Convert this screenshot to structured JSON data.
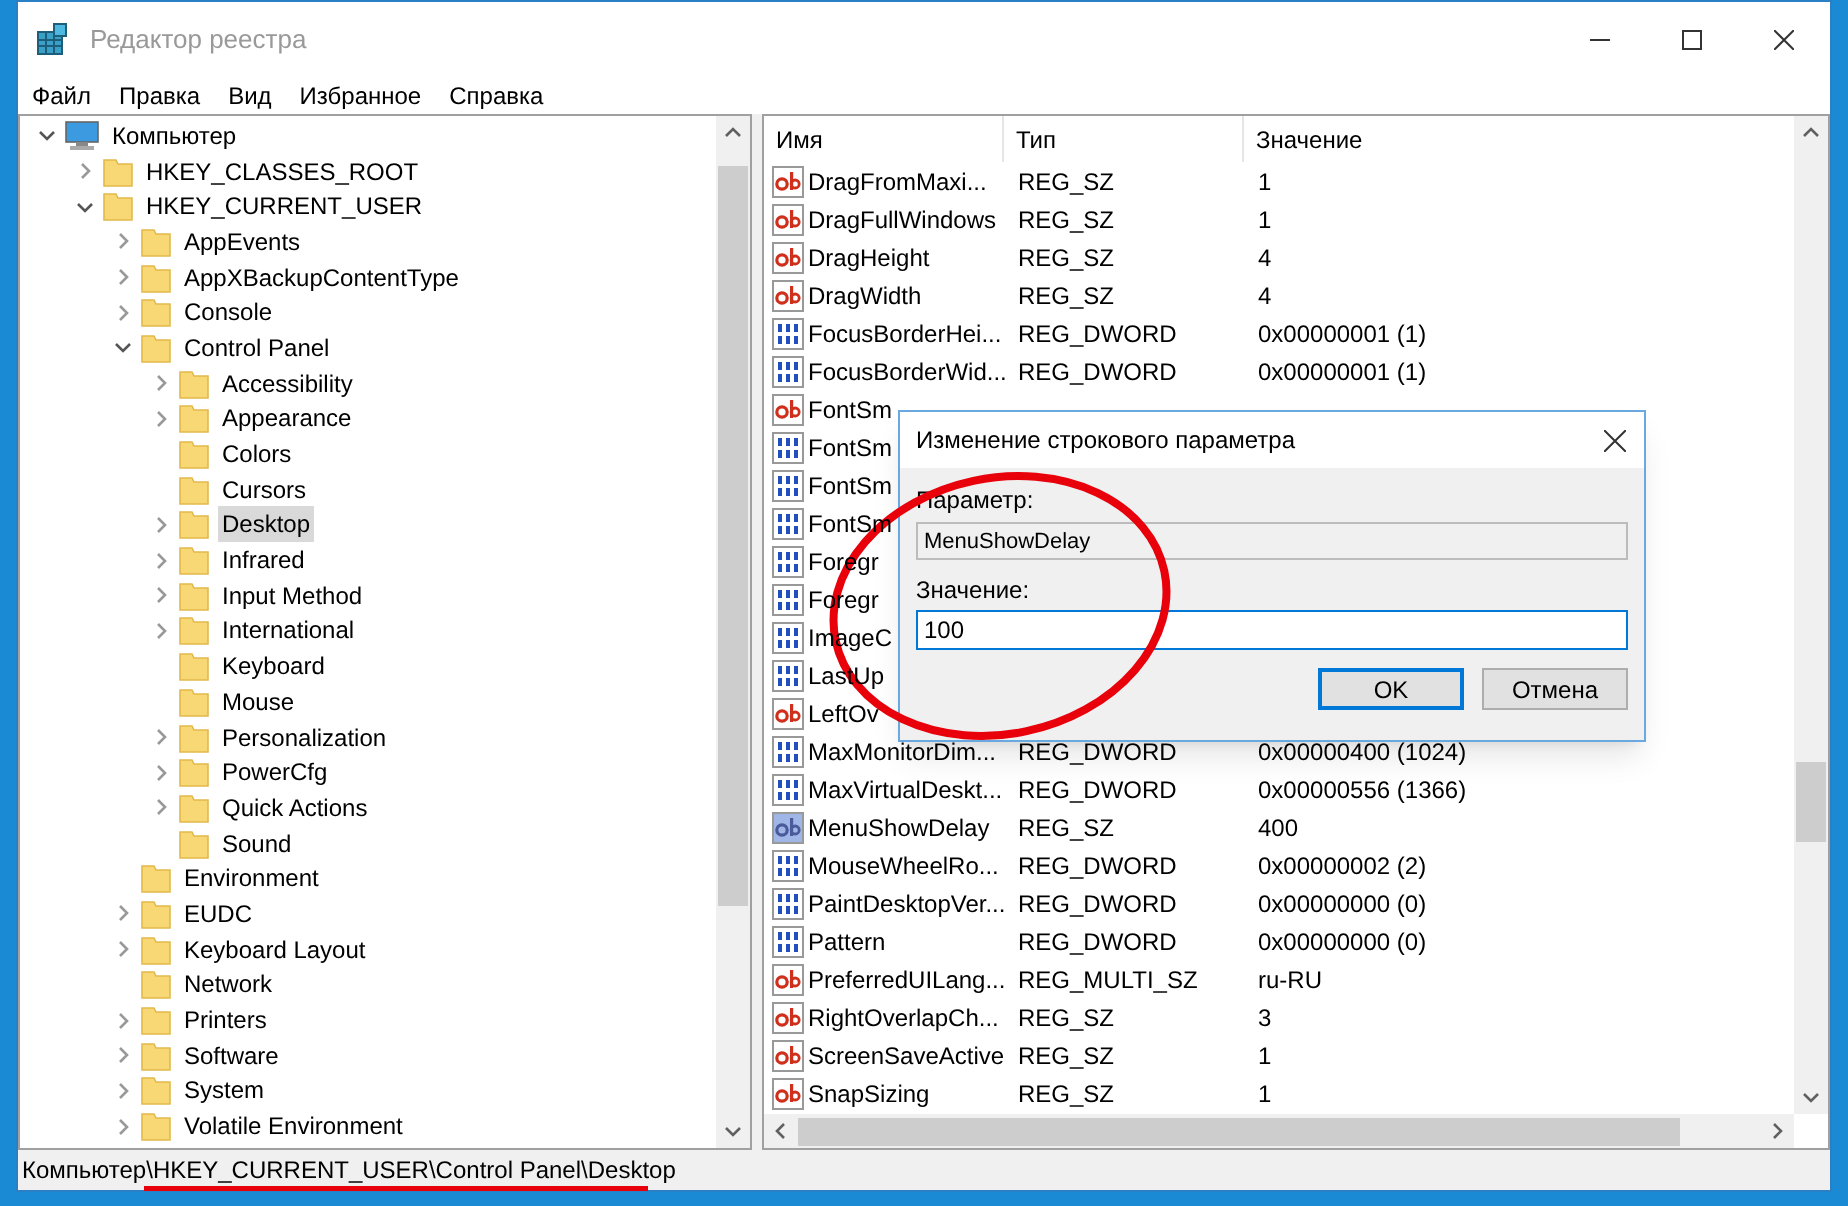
{
  "window": {
    "title": "Редактор реестра"
  },
  "menu": [
    "Файл",
    "Правка",
    "Вид",
    "Избранное",
    "Справка"
  ],
  "tree": [
    {
      "label": "Компьютер",
      "kind": "computer",
      "expandable": true,
      "expanded": true,
      "selected": false,
      "children": [
        {
          "label": "HKEY_CLASSES_ROOT",
          "expandable": true,
          "expanded": false,
          "selected": false
        },
        {
          "label": "HKEY_CURRENT_USER",
          "expandable": true,
          "expanded": true,
          "selected": false,
          "children": [
            {
              "label": "AppEvents",
              "expandable": true,
              "expanded": false,
              "selected": false
            },
            {
              "label": "AppXBackupContentType",
              "expandable": true,
              "expanded": false,
              "selected": false
            },
            {
              "label": "Console",
              "expandable": true,
              "expanded": false,
              "selected": false
            },
            {
              "label": "Control Panel",
              "expandable": true,
              "expanded": true,
              "selected": false,
              "children": [
                {
                  "label": "Accessibility",
                  "expandable": true,
                  "expanded": false,
                  "selected": false
                },
                {
                  "label": "Appearance",
                  "expandable": true,
                  "expanded": false,
                  "selected": false
                },
                {
                  "label": "Colors",
                  "expandable": false,
                  "expanded": false,
                  "selected": false
                },
                {
                  "label": "Cursors",
                  "expandable": false,
                  "expanded": false,
                  "selected": false
                },
                {
                  "label": "Desktop",
                  "expandable": true,
                  "expanded": false,
                  "selected": true
                },
                {
                  "label": "Infrared",
                  "expandable": true,
                  "expanded": false,
                  "selected": false
                },
                {
                  "label": "Input Method",
                  "expandable": true,
                  "expanded": false,
                  "selected": false
                },
                {
                  "label": "International",
                  "expandable": true,
                  "expanded": false,
                  "selected": false
                },
                {
                  "label": "Keyboard",
                  "expandable": false,
                  "expanded": false,
                  "selected": false
                },
                {
                  "label": "Mouse",
                  "expandable": false,
                  "expanded": false,
                  "selected": false
                },
                {
                  "label": "Personalization",
                  "expandable": true,
                  "expanded": false,
                  "selected": false
                },
                {
                  "label": "PowerCfg",
                  "expandable": true,
                  "expanded": false,
                  "selected": false
                },
                {
                  "label": "Quick Actions",
                  "expandable": true,
                  "expanded": false,
                  "selected": false
                },
                {
                  "label": "Sound",
                  "expandable": false,
                  "expanded": false,
                  "selected": false
                }
              ]
            },
            {
              "label": "Environment",
              "expandable": false,
              "expanded": false,
              "selected": false
            },
            {
              "label": "EUDC",
              "expandable": true,
              "expanded": false,
              "selected": false
            },
            {
              "label": "Keyboard Layout",
              "expandable": true,
              "expanded": false,
              "selected": false
            },
            {
              "label": "Network",
              "expandable": false,
              "expanded": false,
              "selected": false
            },
            {
              "label": "Printers",
              "expandable": true,
              "expanded": false,
              "selected": false
            },
            {
              "label": "Software",
              "expandable": true,
              "expanded": false,
              "selected": false
            },
            {
              "label": "System",
              "expandable": true,
              "expanded": false,
              "selected": false
            },
            {
              "label": "Volatile Environment",
              "expandable": true,
              "expanded": false,
              "selected": false
            }
          ]
        }
      ]
    }
  ],
  "table": {
    "columns": [
      "Имя",
      "Тип",
      "Значение"
    ],
    "rows": [
      {
        "kind": "string",
        "name": "DragFromMaxi...",
        "type": "REG_SZ",
        "value": "1",
        "selected": false
      },
      {
        "kind": "string",
        "name": "DragFullWindows",
        "type": "REG_SZ",
        "value": "1",
        "selected": false
      },
      {
        "kind": "string",
        "name": "DragHeight",
        "type": "REG_SZ",
        "value": "4",
        "selected": false
      },
      {
        "kind": "string",
        "name": "DragWidth",
        "type": "REG_SZ",
        "value": "4",
        "selected": false
      },
      {
        "kind": "binary",
        "name": "FocusBorderHei...",
        "type": "REG_DWORD",
        "value": "0x00000001 (1)",
        "selected": false
      },
      {
        "kind": "binary",
        "name": "FocusBorderWid...",
        "type": "REG_DWORD",
        "value": "0x00000001 (1)",
        "selected": false
      },
      {
        "kind": "string",
        "name": "FontSm",
        "selected": false
      },
      {
        "kind": "binary",
        "name": "FontSm",
        "selected": false
      },
      {
        "kind": "binary",
        "name": "FontSm",
        "selected": false
      },
      {
        "kind": "binary",
        "name": "FontSm",
        "selected": false
      },
      {
        "kind": "binary",
        "name": "Foregr",
        "selected": false
      },
      {
        "kind": "binary",
        "name": "Foregr",
        "selected": false
      },
      {
        "kind": "binary",
        "name": "ImageC",
        "selected": false
      },
      {
        "kind": "binary",
        "name": "LastUp",
        "selected": false
      },
      {
        "kind": "string",
        "name": "LeftOv",
        "selected": false
      },
      {
        "kind": "binary",
        "name": "MaxMonitorDim...",
        "type": "REG_DWORD",
        "value": "0x00000400 (1024)",
        "selected": false
      },
      {
        "kind": "binary",
        "name": "MaxVirtualDeskt...",
        "type": "REG_DWORD",
        "value": "0x00000556 (1366)",
        "selected": false
      },
      {
        "kind": "string",
        "name": "MenuShowDelay",
        "type": "REG_SZ",
        "value": "400",
        "selected": true
      },
      {
        "kind": "binary",
        "name": "MouseWheelRo...",
        "type": "REG_DWORD",
        "value": "0x00000002 (2)",
        "selected": false
      },
      {
        "kind": "binary",
        "name": "PaintDesktopVer...",
        "type": "REG_DWORD",
        "value": "0x00000000 (0)",
        "selected": false
      },
      {
        "kind": "binary",
        "name": "Pattern",
        "type": "REG_DWORD",
        "value": "0x00000000 (0)",
        "selected": false
      },
      {
        "kind": "string",
        "name": "PreferredUILang...",
        "type": "REG_MULTI_SZ",
        "value": "ru-RU",
        "selected": false
      },
      {
        "kind": "string",
        "name": "RightOverlapCh...",
        "type": "REG_SZ",
        "value": "3",
        "selected": false
      },
      {
        "kind": "string",
        "name": "ScreenSaveActive",
        "type": "REG_SZ",
        "value": "1",
        "selected": false
      },
      {
        "kind": "string",
        "name": "SnapSizing",
        "type": "REG_SZ",
        "value": "1",
        "selected": false
      }
    ]
  },
  "dialog": {
    "title": "Изменение строкового параметра",
    "name_label": "Параметр:",
    "name_value": "MenuShowDelay",
    "value_label": "Значение:",
    "value": "100",
    "buttons": [
      {
        "label": "OK",
        "default": true
      },
      {
        "label": "Отмена",
        "default": false
      }
    ]
  },
  "status_bar": "Компьютер\\HKEY_CURRENT_USER\\Control Panel\\Desktop"
}
